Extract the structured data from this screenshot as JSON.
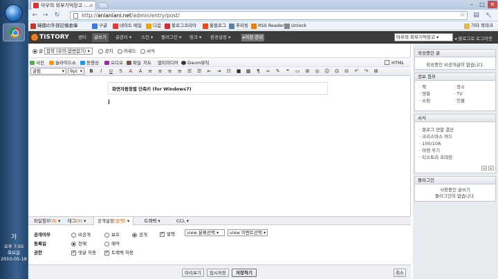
{
  "taskbar": {
    "clock_lines": [
      "오후 7:55",
      "화요일",
      "2010-05-18"
    ],
    "lang_indicator": "가"
  },
  "browser": {
    "tab_title": "아우의 외부기억장고 :...",
    "tab_close": "×",
    "url_host": "anianiani.net",
    "url_path": "/admin/entry/post/",
    "url_scheme": "http://",
    "back": "←",
    "forward": "→",
    "reload": "↻",
    "star": "☆",
    "page_menu": "▤",
    "tools_menu": "🔧",
    "min": "–",
    "max": "□",
    "close": "✕",
    "bookmarks": [
      {
        "label": "韓國の外部記憶倉庫",
        "color": "#c0392b"
      },
      {
        "label": "구글",
        "color": "#3b78e7"
      },
      {
        "label": "네이트 메일",
        "color": "#e53935"
      },
      {
        "label": "다음",
        "color": "#f0a30a"
      },
      {
        "label": "블로그코리아",
        "color": "#d32f2f"
      },
      {
        "label": "올블로그",
        "color": "#e64a19"
      },
      {
        "label": "푸리링",
        "color": "#5c7ea8"
      },
      {
        "label": "RSS Reader",
        "color": "#f57c00"
      },
      {
        "label": "Unlock",
        "color": "#888888"
      }
    ],
    "other_bookmarks": "기타 북마크"
  },
  "tistory": {
    "logo": "TISTORY",
    "menu": [
      "센터",
      "글쓰기",
      "글관리 ▾",
      "스킨 ▾",
      "플러그인 ▾",
      "링크 ▾",
      "환경설정 ▾",
      "▸이전 관리"
    ],
    "active_menu": "글쓰기",
    "blog_select": "아우의 외부기억장고",
    "blog_home": "블로그로",
    "logout": "로그아웃"
  },
  "editor": {
    "type_options": [
      "글",
      "공지",
      "키워드",
      "서식"
    ],
    "category_select": "잡학 (유의-잡변잡기)",
    "insert_buttons": [
      "사진",
      "슬라이드쇼",
      "동영상",
      "오디오",
      "파일",
      "지도",
      "멀티미디어",
      "Daum뮤직"
    ],
    "insert_colors": [
      "#4caf50",
      "#ff9800",
      "#2196f3",
      "#9c27b0",
      "#795548",
      "#009688",
      "#3f51b5",
      "#e91e63"
    ],
    "html_label": "HTML",
    "font_select": "굴림",
    "size_select": "9pt",
    "format_glyphs": [
      "B",
      "I",
      "U",
      "S",
      "A",
      "A",
      "≡",
      "≡",
      "≡",
      "≡",
      "☰",
      "☰",
      "⇤",
      "⇥",
      "☷",
      "■",
      "▦",
      "¶",
      "∞",
      "✎",
      "❝",
      "▭",
      "⊞",
      "◎",
      "☺",
      "Ω",
      "⊟",
      "↶",
      "↷",
      "⊠"
    ],
    "title": "화면자동정렬 단축키 (for Windows7)"
  },
  "bottom_tabs": [
    {
      "label": "파일첨부",
      "badge": "(0)",
      "tail": " ▾"
    },
    {
      "label": "태그",
      "badge": "(0)",
      "tail": " ▾"
    },
    {
      "label": "공개설정",
      "badge": "(발행)",
      "tail": " ▾"
    },
    {
      "label": "트랙백",
      "badge": "",
      "tail": " ▾"
    },
    {
      "label": "CCL",
      "badge": "",
      "tail": " ▾"
    }
  ],
  "publish": {
    "visibility_label": "공개여부",
    "visibility_options": [
      "비공개",
      "보호",
      "공개"
    ],
    "visibility_selected": 2,
    "issue_label": "발행",
    "issue_checked": true,
    "category_select": "view 분류선택",
    "event_select": "view 이벤트선택",
    "date_label": "등록일",
    "date_options": [
      "현재",
      "예약"
    ],
    "date_selected": 0,
    "perm_label": "권한",
    "perm_options": [
      "댓글 허용",
      "트랙백 허용"
    ],
    "perm_checked": [
      true,
      true
    ]
  },
  "footer": {
    "preview": "미리보기",
    "save_draft": "임시저장",
    "save": "저장하기",
    "cancel": "취소"
  },
  "sidebar": {
    "draft_title": "작성중인 글",
    "draft_empty": "작성중인 비공개글이 없습니다.",
    "info_title": "정보 첨부",
    "info_items": [
      "책",
      "장소",
      "영화",
      "TV",
      "쇼핑",
      "인물"
    ],
    "template_title": "서식",
    "template_items": [
      "블로그 연말 결산",
      "크리스마스 카드",
      "100/10A",
      "여행 후기",
      "티스토리 초대장"
    ],
    "plugin_title": "플러그인",
    "plugin_empty_1": "사용중인 글쓰기",
    "plugin_empty_2": "플러그인이 없습니다."
  }
}
